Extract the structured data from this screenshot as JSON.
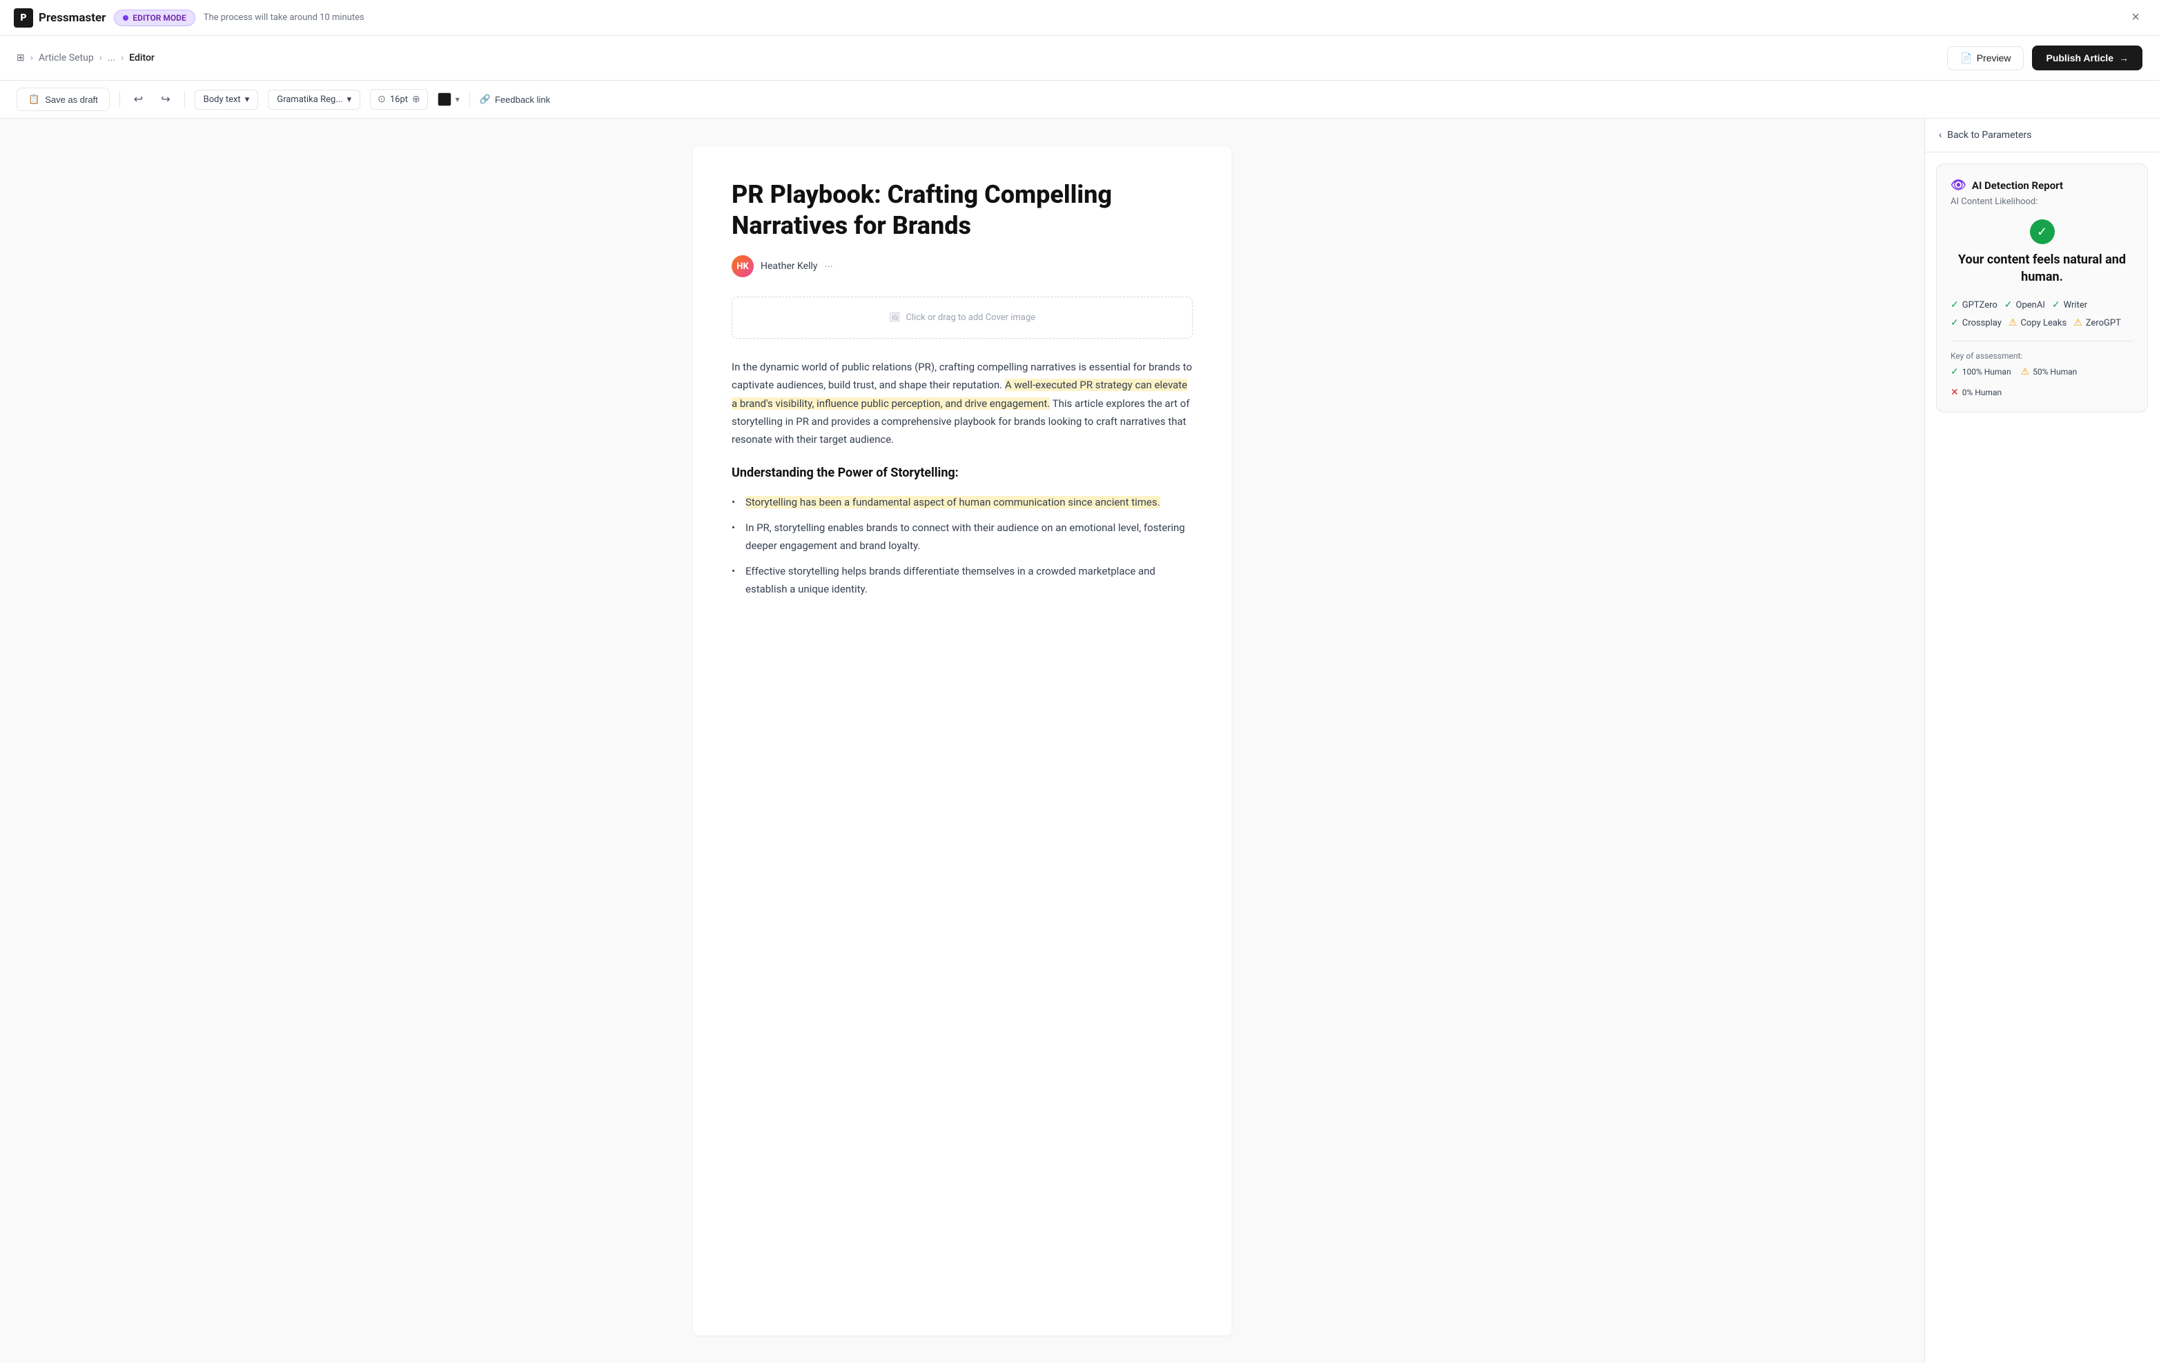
{
  "app": {
    "logo_letter": "P",
    "logo_name": "Pressmaster"
  },
  "topbar": {
    "editor_mode_label": "EDITOR MODE",
    "hint": "The process will take around 10 minutes",
    "close_label": "×"
  },
  "breadcrumb": {
    "grid_label": "⊞",
    "article_setup": "Article Setup",
    "dots": "...",
    "editor": "Editor"
  },
  "header_actions": {
    "preview_label": "Preview",
    "publish_label": "Publish Article"
  },
  "toolbar": {
    "save_draft_label": "Save as draft",
    "style_label": "Body text",
    "font_label": "Gramatika Reg...",
    "font_size": "16pt",
    "feedback_label": "Feedback link"
  },
  "right_panel": {
    "back_label": "Back to Parameters",
    "ai_report_title": "AI Detection Report",
    "ai_content_label": "AI Content Likelihood:",
    "ai_result": "Your content feels natural and human.",
    "detectors": [
      {
        "name": "GPTZero",
        "status": "green"
      },
      {
        "name": "OpenAI",
        "status": "green"
      },
      {
        "name": "Writer",
        "status": "green"
      },
      {
        "name": "Crossplay",
        "status": "green"
      },
      {
        "name": "Copy Leaks",
        "status": "orange"
      },
      {
        "name": "ZeroGPT",
        "status": "orange"
      }
    ],
    "key_label": "Key of assessment:",
    "key_items": [
      {
        "label": "100% Human",
        "type": "green"
      },
      {
        "label": "50% Human",
        "type": "orange"
      },
      {
        "label": "0% Human",
        "type": "red"
      }
    ]
  },
  "article": {
    "title": "PR Playbook: Crafting Compelling Narratives for Brands",
    "author": "Heather Kelly",
    "author_initials": "HK",
    "cover_placeholder": "Click or drag to add Cover image",
    "body_paragraphs": [
      {
        "text_before_highlight": "In the dynamic world of public relations (PR), crafting compelling narratives is essential for brands to captivate audiences, build trust, and shape their reputation. ",
        "text_highlight": "A well-executed PR strategy can elevate a brand's visibility, influence public perception, and drive engagement.",
        "text_after_highlight": " This article explores the art of storytelling in PR and provides a comprehensive playbook for brands looking to craft narratives that resonate with their target audience."
      }
    ],
    "subheading": "Understanding the Power of Storytelling:",
    "bullets": [
      {
        "text_highlight": "Storytelling has been a fundamental aspect of human communication since ancient times.",
        "text_after": ""
      },
      {
        "text_before": "In PR, storytelling enables brands to connect with their audience on an emotional level, fostering deeper engagement and brand loyalty.",
        "text_highlight": "",
        "text_after": ""
      },
      {
        "text_before": "Effective storytelling helps brands differentiate themselves in a crowded marketplace and establish a unique identity.",
        "text_highlight": "",
        "text_after": ""
      }
    ]
  }
}
